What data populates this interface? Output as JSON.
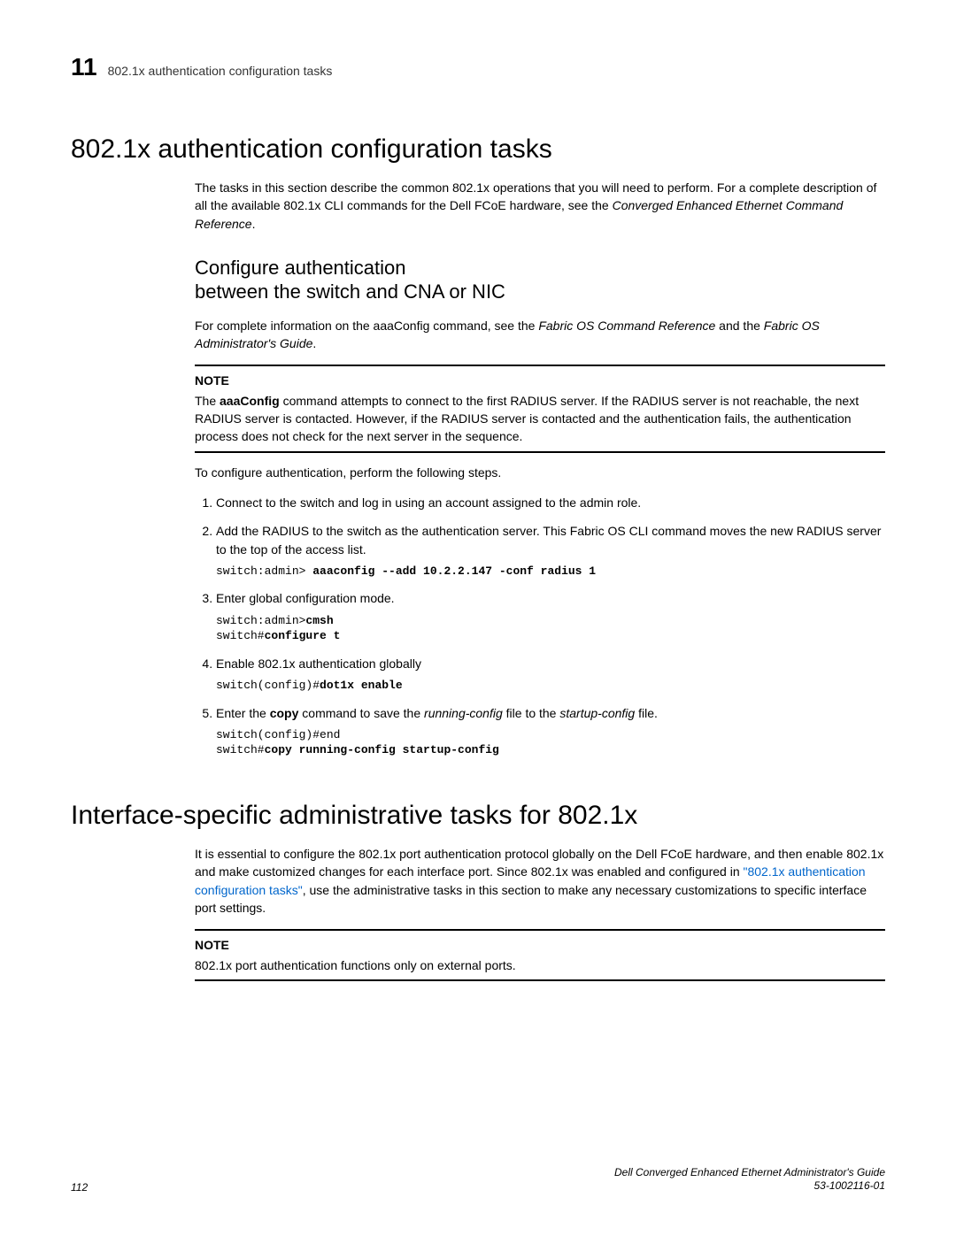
{
  "runhead": {
    "chapter_number": "11",
    "chapter_title": "802.1x authentication configuration tasks"
  },
  "section1": {
    "title": "802.1x authentication configuration tasks",
    "intro_a": "The tasks in this section describe the common 802.1x operations that you will need to perform. For a complete description of all the available 802.1x CLI commands for the Dell FCoE hardware, see the ",
    "intro_italic": "Converged Enhanced Ethernet Command Reference",
    "intro_b": ".",
    "subsection": {
      "title_line1": "Configure authentication",
      "title_line2": "between the switch and CNA or NIC",
      "para1_a": "For complete information on the aaaConfig command, see the ",
      "para1_italic1": "Fabric OS Command Reference",
      "para1_b": " and the ",
      "para1_italic2": "Fabric OS Administrator's Guide",
      "para1_c": ".",
      "note_label": "NOTE",
      "note_a": "The ",
      "note_bold": "aaaConfig",
      "note_b": " command attempts to connect to the first RADIUS server. If the RADIUS server is not reachable, the next RADIUS server is contacted. However, if the RADIUS server is contacted and the authentication fails, the authentication process does not check for the next server in the sequence.",
      "lead": "To configure authentication, perform the following steps.",
      "steps": {
        "s1": "Connect to the switch and log in using an account assigned to the admin role.",
        "s2": "Add the RADIUS to the switch as the authentication server. This Fabric OS CLI command moves the new RADIUS server to the top of the access list.",
        "s2_code_prompt": "switch:admin> ",
        "s2_code_bold": "aaaconfig --add 10.2.2.147 -conf radius 1",
        "s3": "Enter global configuration mode.",
        "s3_code_l1_prompt": "switch:admin>",
        "s3_code_l1_bold": "cmsh",
        "s3_code_l2_prompt": "switch#",
        "s3_code_l2_bold": "configure t",
        "s4": "Enable 802.1x authentication globally",
        "s4_code_prompt": "switch(config)#",
        "s4_code_bold": "dot1x enable",
        "s5_a": "Enter the ",
        "s5_bold": "copy",
        "s5_b": " command to save the ",
        "s5_italic1": "running-config",
        "s5_c": " file to the ",
        "s5_italic2": "startup-config",
        "s5_d": " file.",
        "s5_code_l1": "switch(config)#end",
        "s5_code_l2_prompt": "switch#",
        "s5_code_l2_bold": "copy running-config startup-config"
      }
    }
  },
  "section2": {
    "title": "Interface-specific administrative tasks for 802.1x",
    "para_a": "It is essential to configure the 802.1x port authentication protocol globally on the Dell FCoE hardware, and then enable 802.1x and make customized changes for each interface port. Since 802.1x was enabled and configured in ",
    "para_link": "\"802.1x authentication configuration tasks\"",
    "para_b": ", use the administrative tasks in this section to make any necessary customizations to specific interface port settings.",
    "note_label": "NOTE",
    "note_body": "802.1x port authentication functions only on external ports."
  },
  "footer": {
    "page": "112",
    "right1": "Dell Converged Enhanced Ethernet Administrator's Guide",
    "right2": "53-1002116-01"
  }
}
